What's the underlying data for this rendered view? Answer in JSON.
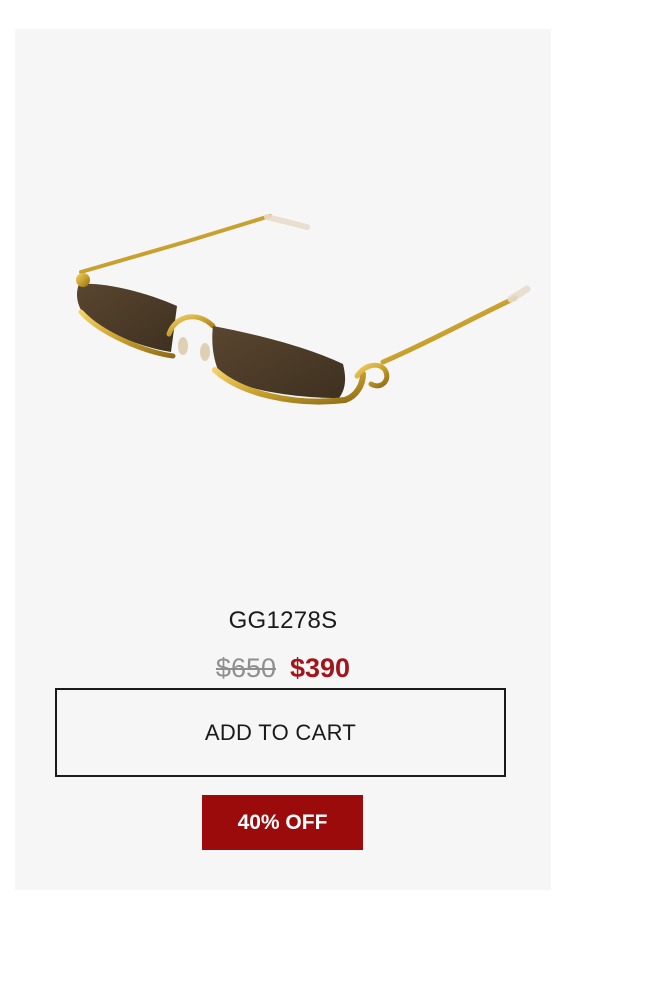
{
  "product": {
    "image_alt": "GG1278S",
    "name": "GG1278S",
    "price_original": "$650",
    "price_sale": "$390",
    "add_to_cart_label": "ADD TO CART",
    "discount_label": "40% OFF"
  },
  "colors": {
    "card_background": "#f6f6f6",
    "sale_price": "#a0161a",
    "badge_background": "#9b0b0b",
    "frame_gold": "#c9a12e",
    "lens_brown": "#4b3a27"
  }
}
